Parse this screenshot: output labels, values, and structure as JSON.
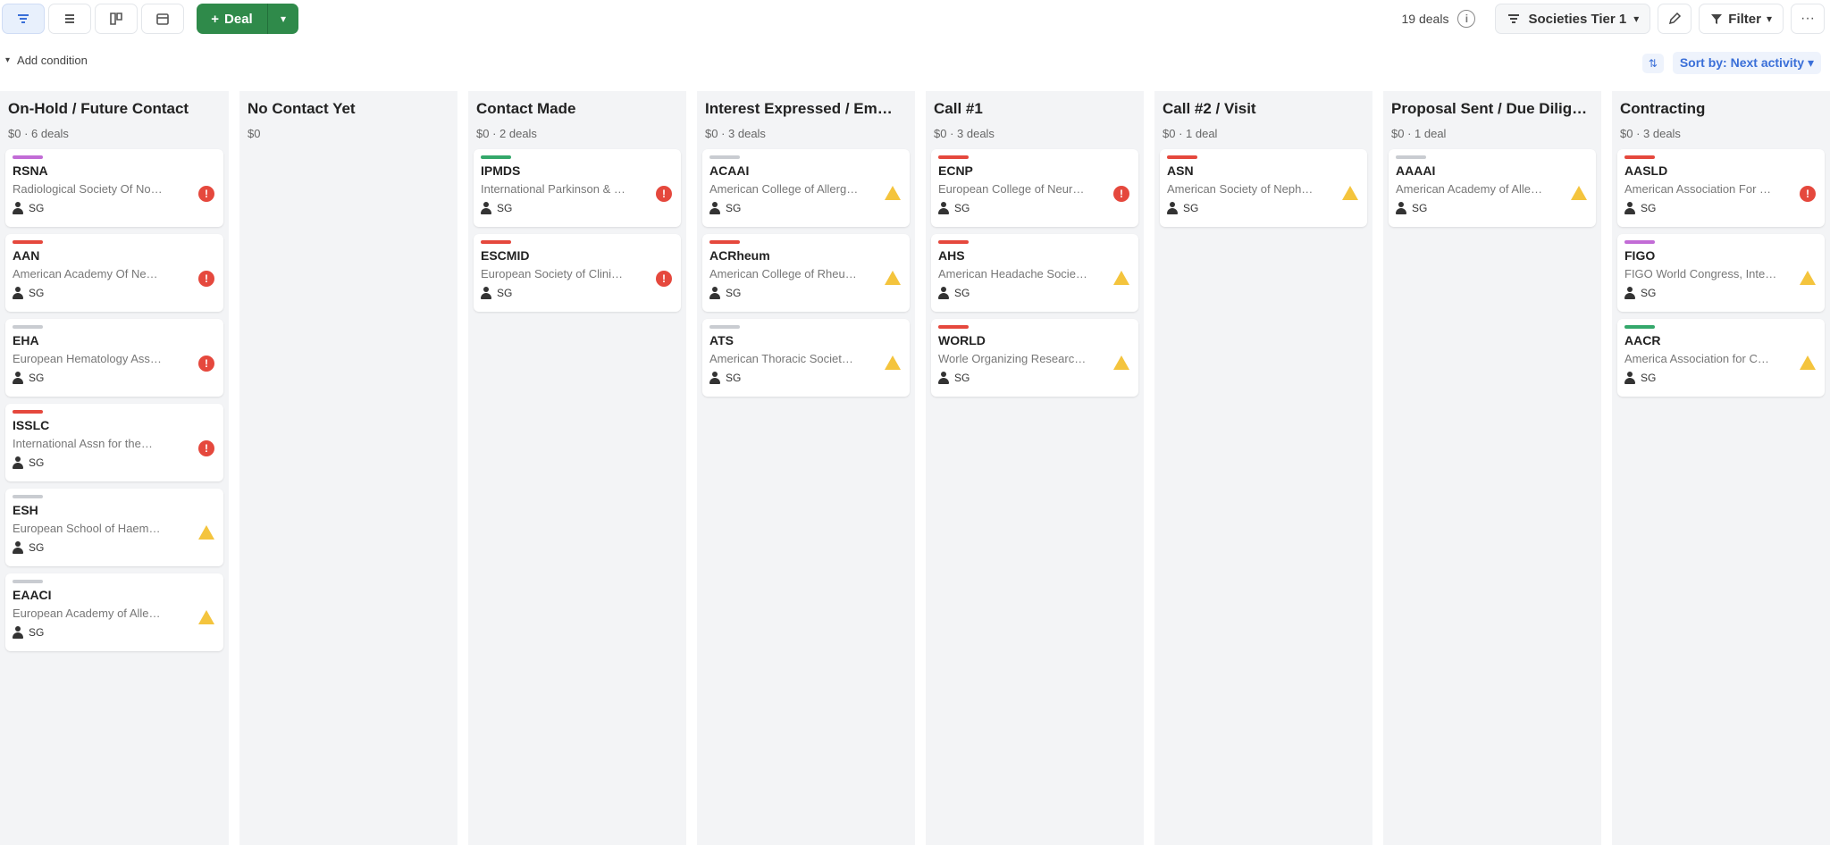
{
  "toolbar": {
    "view_buttons": [
      {
        "name": "pipeline-view-icon",
        "active": true
      },
      {
        "name": "list-view-icon",
        "active": false
      },
      {
        "name": "forecast-view-icon",
        "active": false
      },
      {
        "name": "calendar-view-icon",
        "active": false
      }
    ],
    "add_deal_label": "Deal",
    "deal_count": "19 deals",
    "pipeline_label": "Societies Tier 1",
    "filter_label": "Filter",
    "more_label": "···"
  },
  "conditions": {
    "add_label": "Add condition"
  },
  "sort": {
    "label": "Sort by: Next activity"
  },
  "colors": {
    "accent_green": "#2f8a4a",
    "accent_blue": "#3a6fd8",
    "tag_red": "#e5483d",
    "tag_purple": "#c26cd6",
    "tag_green": "#34a86b",
    "tag_gray": "#c9ccd1",
    "status_red": "#e5483d",
    "status_warning": "#f4c43d"
  },
  "columns": [
    {
      "title": "On-Hold / Future Contact",
      "meta": "$0 · 6 deals",
      "cards": [
        {
          "title": "RSNA",
          "sub": "Radiological Society Of No…",
          "owner": "SG",
          "tag": "purple",
          "status": "red"
        },
        {
          "title": "AAN",
          "sub": "American Academy Of Ne…",
          "owner": "SG",
          "tag": "red",
          "status": "red"
        },
        {
          "title": "EHA",
          "sub": "European Hematology Ass…",
          "owner": "SG",
          "tag": "gray",
          "status": "red"
        },
        {
          "title": "ISSLC",
          "sub": "International Assn for the…",
          "owner": "SG",
          "tag": "red",
          "status": "red"
        },
        {
          "title": "ESH",
          "sub": "European School of Haem…",
          "owner": "SG",
          "tag": "gray",
          "status": "warning"
        },
        {
          "title": "EAACI",
          "sub": "European Academy of Alle…",
          "owner": "SG",
          "tag": "gray",
          "status": "warning"
        }
      ]
    },
    {
      "title": "No Contact Yet",
      "meta": "$0",
      "cards": []
    },
    {
      "title": "Contact Made",
      "meta": "$0 · 2 deals",
      "cards": [
        {
          "title": "IPMDS",
          "sub": "International Parkinson & …",
          "owner": "SG",
          "tag": "green",
          "status": "red"
        },
        {
          "title": "ESCMID",
          "sub": "European Society of Clini…",
          "owner": "SG",
          "tag": "red",
          "status": "red"
        }
      ]
    },
    {
      "title": "Interest Expressed / Em…",
      "meta": "$0 · 3 deals",
      "cards": [
        {
          "title": "ACAAI",
          "sub": "American College of Allerg…",
          "owner": "SG",
          "tag": "gray",
          "status": "warning"
        },
        {
          "title": "ACRheum",
          "sub": "American College of Rheu…",
          "owner": "SG",
          "tag": "red",
          "status": "warning"
        },
        {
          "title": "ATS",
          "sub": "American Thoracic Societ…",
          "owner": "SG",
          "tag": "gray",
          "status": "warning"
        }
      ]
    },
    {
      "title": "Call #1",
      "meta": "$0 · 3 deals",
      "cards": [
        {
          "title": "ECNP",
          "sub": "European College of Neur…",
          "owner": "SG",
          "tag": "red",
          "status": "red"
        },
        {
          "title": "AHS",
          "sub": "American Headache Socie…",
          "owner": "SG",
          "tag": "red",
          "status": "warning"
        },
        {
          "title": "WORLD",
          "sub": "Worle Organizing Researc…",
          "owner": "SG",
          "tag": "red",
          "status": "warning"
        }
      ]
    },
    {
      "title": "Call #2 / Visit",
      "meta": "$0 · 1 deal",
      "cards": [
        {
          "title": "ASN",
          "sub": "American Society of Neph…",
          "owner": "SG",
          "tag": "red",
          "status": "warning"
        }
      ]
    },
    {
      "title": "Proposal Sent / Due Dilig…",
      "meta": "$0 · 1 deal",
      "cards": [
        {
          "title": "AAAAI",
          "sub": "American Academy of Alle…",
          "owner": "SG",
          "tag": "gray",
          "status": "warning"
        }
      ]
    },
    {
      "title": "Contracting",
      "meta": "$0 · 3 deals",
      "cards": [
        {
          "title": "AASLD",
          "sub": "American Association For …",
          "owner": "SG",
          "tag": "red",
          "status": "red"
        },
        {
          "title": "FIGO",
          "sub": "FIGO World Congress, Inte…",
          "owner": "SG",
          "tag": "purple",
          "status": "warning"
        },
        {
          "title": "AACR",
          "sub": "America Association for C…",
          "owner": "SG",
          "tag": "green",
          "status": "warning"
        }
      ]
    }
  ]
}
